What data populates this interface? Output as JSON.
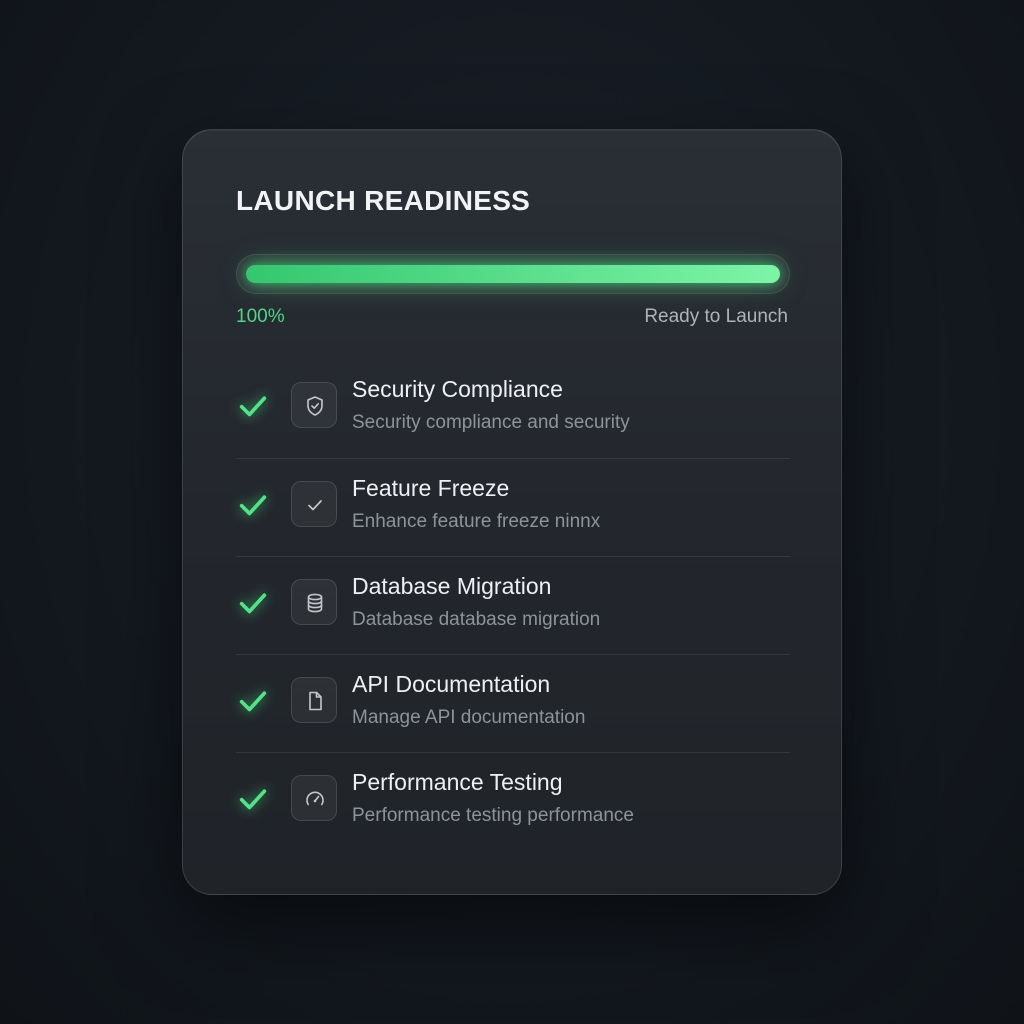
{
  "card": {
    "title": "LAUNCH READINESS",
    "progress": {
      "value": 1.0,
      "percent_label": "100%",
      "status_label": "Ready to Launch"
    },
    "items": [
      {
        "title": "Security Compliance",
        "description": "Security compliance and security",
        "icon": "shield-check-icon",
        "checked": true
      },
      {
        "title": "Feature Freeze",
        "description": "Enhance feature freeze ninnx",
        "icon": "checkmark-icon",
        "checked": true
      },
      {
        "title": "Database Migration",
        "description": "Database database migration",
        "icon": "database-icon",
        "checked": true
      },
      {
        "title": "API Documentation",
        "description": "Manage API documentation",
        "icon": "document-icon",
        "checked": true
      },
      {
        "title": "Performance Testing",
        "description": "Performance testing performance",
        "icon": "speedometer-icon",
        "checked": true
      }
    ]
  },
  "colors": {
    "accent": "#4cd883",
    "background": "#141920",
    "card": "#25292f"
  }
}
